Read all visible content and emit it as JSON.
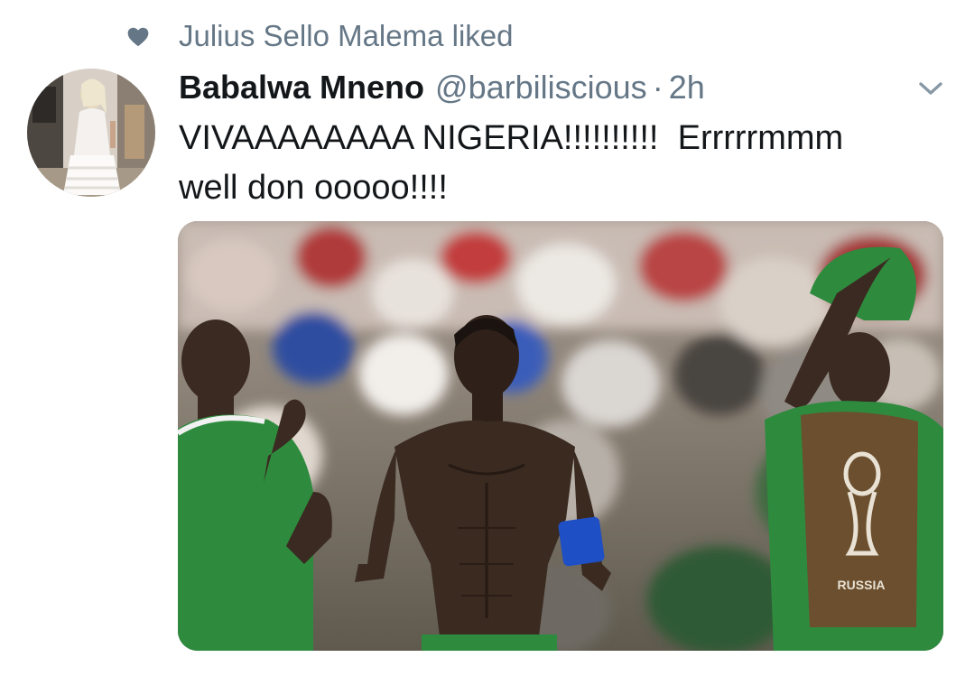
{
  "social_context": {
    "icon": "heart-icon",
    "text": "Julius Sello Malema liked"
  },
  "tweet": {
    "author": {
      "display_name": "Babalwa Mneno",
      "handle": "@barbiliscious"
    },
    "separator": "·",
    "timestamp": "2h",
    "text": "VIVAAAAAAAA NIGERIA!!!!!!!!!!  Errrrrmmm\nwell don ooooo!!!!",
    "media_overlay_text": "RUSSIA"
  },
  "colors": {
    "secondary_text": "#657786",
    "primary_text": "#14171a",
    "jersey_green": "#2e8b3e",
    "armband_blue": "#1f4fc4"
  }
}
